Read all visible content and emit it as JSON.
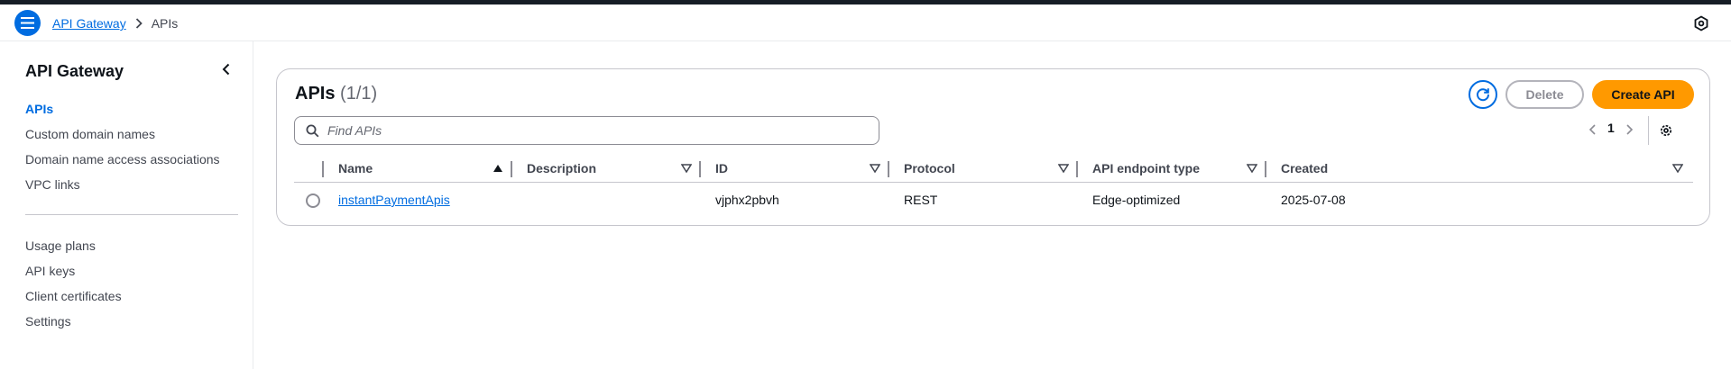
{
  "breadcrumb": {
    "root": "API Gateway",
    "current": "APIs"
  },
  "sidebar": {
    "title": "API Gateway",
    "items": [
      {
        "label": "APIs",
        "active": true
      },
      {
        "label": "Custom domain names"
      },
      {
        "label": "Domain name access associations"
      },
      {
        "label": "VPC links"
      },
      {
        "label": "Usage plans"
      },
      {
        "label": "API keys"
      },
      {
        "label": "Client certificates"
      },
      {
        "label": "Settings"
      }
    ]
  },
  "main": {
    "title": "APIs",
    "count": "(1/1)",
    "delete_label": "Delete",
    "create_label": "Create API",
    "search_placeholder": "Find APIs",
    "page": "1",
    "columns": [
      "Name",
      "Description",
      "ID",
      "Protocol",
      "API endpoint type",
      "Created"
    ],
    "rows": [
      {
        "name": "instantPaymentApis",
        "description": "",
        "id": "vjphx2pbvh",
        "protocol": "REST",
        "endpoint_type": "Edge-optimized",
        "created": "2025-07-08"
      }
    ]
  },
  "colors": {
    "accent": "#006ce0",
    "primary_button": "#ff9900",
    "top_strip": "#161d26"
  },
  "icons": [
    "menu-icon",
    "chevron-right-icon",
    "gear-hex-icon",
    "chevron-left-icon",
    "refresh-icon",
    "search-icon",
    "settings-icon",
    "sort-ascending-icon",
    "sort-descending-icon"
  ]
}
